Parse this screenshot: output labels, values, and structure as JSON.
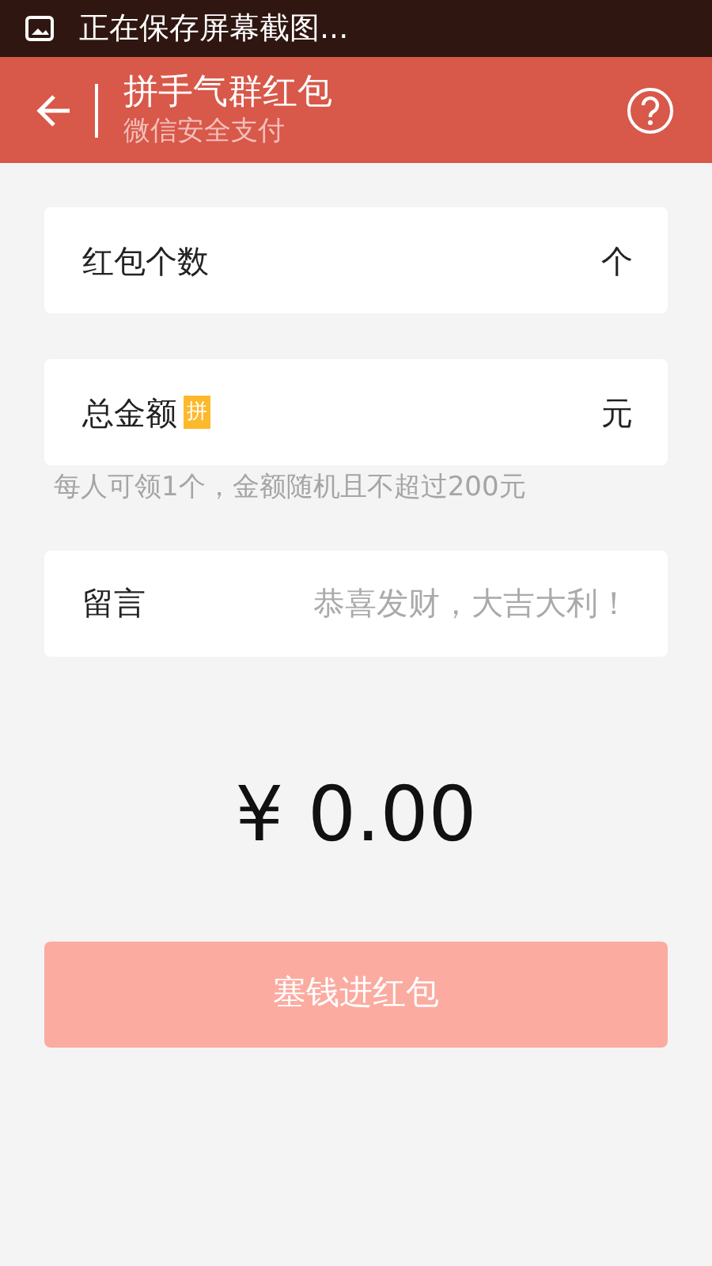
{
  "status_bar": {
    "notification": "正在保存屏幕截图..."
  },
  "header": {
    "title": "拼手气群红包",
    "subtitle": "微信安全支付"
  },
  "fields": [
    {
      "label": "红包个数",
      "unit": "个"
    },
    {
      "label": "总金额",
      "tag": "拼",
      "unit": "元",
      "hint": "每人可领1个，金额随机且不超过200元"
    },
    {
      "label": "留言",
      "placeholder": "恭喜发财，大吉大利！"
    }
  ],
  "amount": "¥ 0.00",
  "submit": {
    "label": "塞钱进红包",
    "disabled": true
  }
}
